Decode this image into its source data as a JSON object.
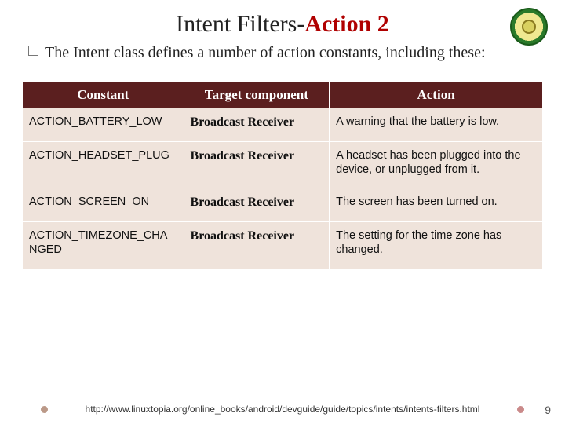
{
  "title_plain": "Intent Filters-",
  "title_em": "Action 2",
  "lead": "The Intent class defines a number of action constants, including these:",
  "table": {
    "headers": [
      "Constant",
      "Target component",
      "Action"
    ],
    "rows": [
      {
        "constant": "ACTION_BATTERY_LOW",
        "target": "Broadcast Receiver",
        "action": "A warning that the battery is low."
      },
      {
        "constant": "ACTION_HEADSET_PLUG",
        "target": "Broadcast Receiver",
        "action": "A headset has been plugged into the device, or unplugged from it."
      },
      {
        "constant": "ACTION_SCREEN_ON",
        "target": "Broadcast Receiver",
        "action": "The screen has been turned on."
      },
      {
        "constant": "ACTION_TIMEZONE_CHANGED",
        "target": "Broadcast Receiver",
        "action": "The setting for the time zone has changed."
      }
    ]
  },
  "footer_url": "http://www.linuxtopia.org/online_books/android/devguide/guide/topics/intents/intents-filters.html",
  "page_number": "9"
}
